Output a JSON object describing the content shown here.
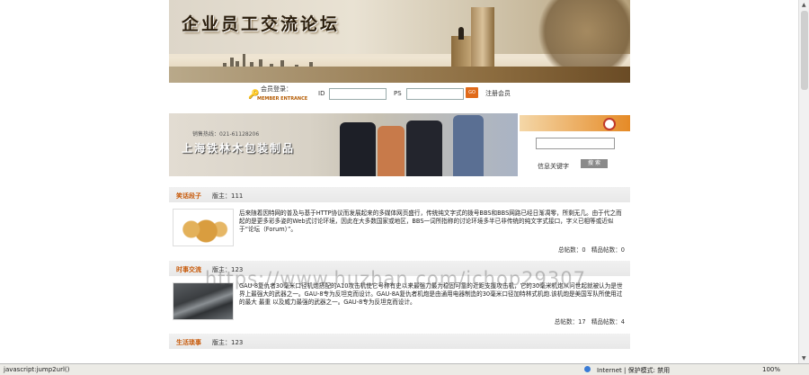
{
  "banner": {
    "title": "企业员工交流论坛"
  },
  "login": {
    "label": "会员登录：",
    "label_en": "MEMBER ENTRANCE",
    "id_label": "ID",
    "ps_label": "PS",
    "go_label": "GO",
    "register": "注册会员"
  },
  "ad": {
    "hotline": "销售热线：021-61128206",
    "brand": "上海铁林木包装制品"
  },
  "search": {
    "keyword_label": "信息关键字",
    "button": "搜 索"
  },
  "sections": [
    {
      "name": "笑话段子",
      "moderator": "版主：111",
      "description": "后来随着因特网的普及与基于HTTP协议而发展起来的多媒体网页盛行，传统纯文字式的拨号BBS和BBS网路已经日渐凋零，所剩无几。由于代之而起的是更多彩多姿的Web式讨论环境，因此在大多数国家或地区，BBS一词所指称的讨论环境多半已非传统的纯文字式接口，字义已相等或近似于“论坛（Forum）”。",
      "posts": "总帖数：0",
      "featured": "精品帖数：0"
    },
    {
      "name": "时事交流",
      "moderator": "版主：123",
      "description": "GAU-8复仇者30毫米口径机炮搭配的A10攻击机使它号称有史以来最强力最为稳固可靠的近距支援攻击机，它的30毫米机炮从问世起就被认为是世界上最强大的武器之一。GAU-8专为反坦克而设计。GAU-8A复仇者机炮是由通用电器制造的30毫米口径加特林式机炮.该机炮是美国军队所使用过的最大 最重 以及威力最强的武器之一。GAU-8专为反坦克而设计。",
      "posts": "总帖数：17",
      "featured": "精品帖数：4"
    },
    {
      "name": "生活琐事",
      "moderator": "版主：123"
    }
  ],
  "watermark": "https://www.huzhan.com/ichop29307",
  "statusbar": {
    "url": "javascript:jump2url()",
    "zone": "Internet | 保护模式: 禁用",
    "zoom": "100%"
  }
}
